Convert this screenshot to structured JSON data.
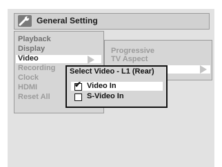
{
  "header": {
    "title": "General Setting",
    "icon": "wrench-icon"
  },
  "main_menu": {
    "items": [
      {
        "label": "Playback",
        "state": "inactive"
      },
      {
        "label": "Display",
        "state": "inactive"
      },
      {
        "label": "Video",
        "state": "selected"
      },
      {
        "label": "Recording",
        "state": "inactive"
      },
      {
        "label": "Clock",
        "state": "inactive"
      },
      {
        "label": "HDMI",
        "state": "inactive"
      },
      {
        "label": "Reset All",
        "state": "inactive"
      }
    ]
  },
  "sub_menu": {
    "items": [
      {
        "label": "Progressive"
      },
      {
        "label": "TV Aspect"
      }
    ]
  },
  "popup": {
    "title": "Select Video - L1 (Rear)",
    "options": [
      {
        "label": "Video In",
        "checked": true,
        "highlighted": true
      },
      {
        "label": "S-Video In",
        "checked": false,
        "highlighted": false
      }
    ]
  },
  "colors": {
    "panel": "#d6d6d6",
    "highlight": "#ffffff",
    "text_active": "#222222",
    "text_inactive": "#9b9b9b",
    "popup_border": "#111111"
  }
}
